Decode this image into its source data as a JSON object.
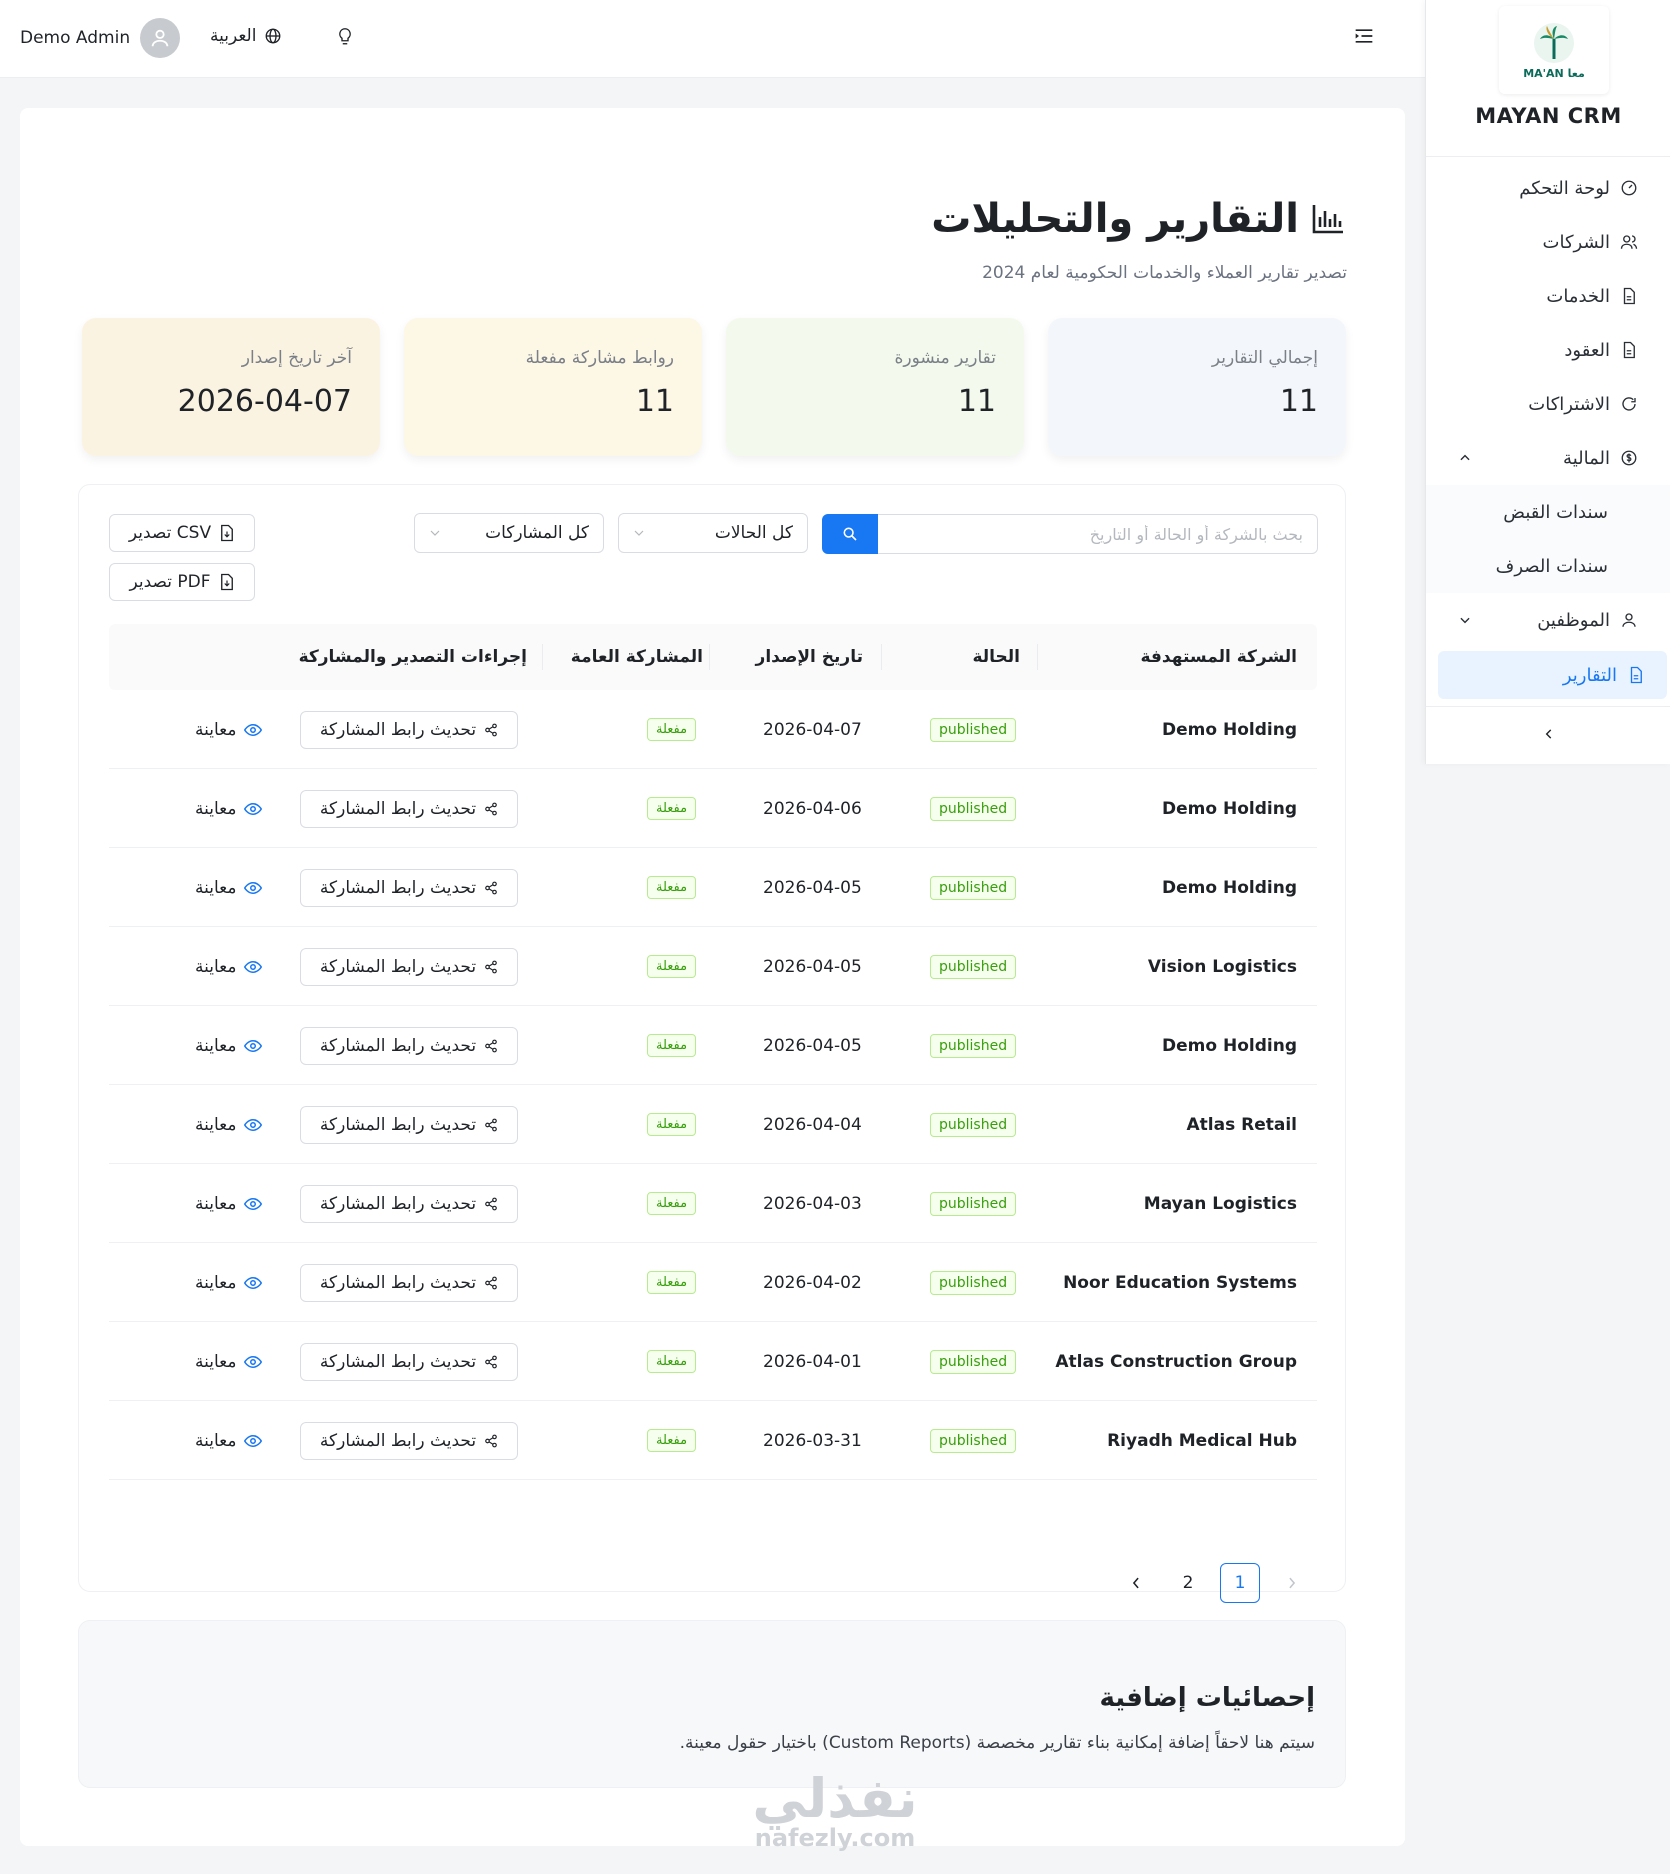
{
  "topbar": {
    "user_name": "Demo Admin",
    "language": "العربية"
  },
  "sidebar": {
    "logo_text": "MA'AN معا",
    "brand": "MAYAN CRM",
    "items": [
      {
        "label": "لوحة التحكم",
        "icon": "dashboard-icon"
      },
      {
        "label": "الشركات",
        "icon": "users-icon"
      },
      {
        "label": "الخدمات",
        "icon": "file-icon"
      },
      {
        "label": "العقود",
        "icon": "file-icon"
      },
      {
        "label": "الاشتراكات",
        "icon": "refresh-icon"
      },
      {
        "label": "المالية",
        "icon": "dollar-icon"
      }
    ],
    "finance_sub": [
      "سندات القبض",
      "سندات الصرف"
    ],
    "employees": "الموظفين",
    "reports": "التقارير"
  },
  "page": {
    "title": "التقارير والتحليلات",
    "subtitle": "تصدير تقارير العملاء والخدمات الحكومية لعام 2024"
  },
  "stats": [
    {
      "label": "إجمالي التقارير",
      "value": "11",
      "bg": "#f3f7fb"
    },
    {
      "label": "تقارير منشورة",
      "value": "11",
      "bg": "#f3faed"
    },
    {
      "label": "روابط مشاركة مفعلة",
      "value": "11",
      "bg": "#fdf7e6"
    },
    {
      "label": "آخر تاريخ إصدار",
      "value": "2026-04-07",
      "bg": "#fbf3e2"
    }
  ],
  "toolbar": {
    "search_placeholder": "بحث بالشركة أو الحالة أو التاريخ",
    "status_filter": "كل الحالات",
    "share_filter": "كل المشاركات",
    "export_csv": "تصدير CSV",
    "export_pdf": "تصدير PDF"
  },
  "table": {
    "headers": {
      "company": "الشركة المستهدفة",
      "status": "الحالة",
      "date": "تاريخ الإصدار",
      "share": "المشاركة العامة",
      "actions": "إجراءات التصدير والمشاركة"
    },
    "share_button": "تحديث رابط المشاركة",
    "preview_label": "معاينة",
    "rows": [
      {
        "company": "Demo Holding",
        "status": "published",
        "date": "2026-04-07",
        "share": "مفعلة"
      },
      {
        "company": "Demo Holding",
        "status": "published",
        "date": "2026-04-06",
        "share": "مفعلة"
      },
      {
        "company": "Demo Holding",
        "status": "published",
        "date": "2026-04-05",
        "share": "مفعلة"
      },
      {
        "company": "Vision Logistics",
        "status": "published",
        "date": "2026-04-05",
        "share": "مفعلة"
      },
      {
        "company": "Demo Holding",
        "status": "published",
        "date": "2026-04-05",
        "share": "مفعلة"
      },
      {
        "company": "Atlas Retail",
        "status": "published",
        "date": "2026-04-04",
        "share": "مفعلة"
      },
      {
        "company": "Mayan Logistics",
        "status": "published",
        "date": "2026-04-03",
        "share": "مفعلة"
      },
      {
        "company": "Noor Education Systems",
        "status": "published",
        "date": "2026-04-02",
        "share": "مفعلة"
      },
      {
        "company": "Atlas Construction Group",
        "status": "published",
        "date": "2026-04-01",
        "share": "مفعلة"
      },
      {
        "company": "Riyadh Medical Hub",
        "status": "published",
        "date": "2026-03-31",
        "share": "مفعلة"
      }
    ]
  },
  "pagination": {
    "pages": [
      "1",
      "2"
    ],
    "current": "1"
  },
  "extra": {
    "title": "إحصائيات إضافية",
    "text": "سيتم هنا لاحقاً إضافة إمكانية بناء تقارير مخصصة (Custom Reports) باختيار حقول معينة."
  },
  "watermark": {
    "arabic": "نفذلي",
    "latin": "nafezly.com"
  }
}
